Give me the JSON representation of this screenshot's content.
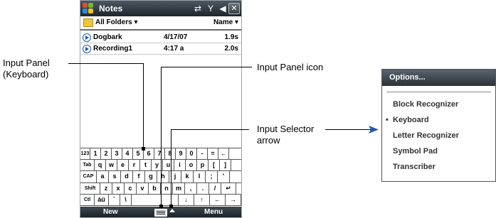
{
  "titlebar": {
    "title": "Notes",
    "close": "✕",
    "conn_glyph": "⇄",
    "signal_glyph": "Y",
    "volume_glyph": "◀"
  },
  "folderbar": {
    "folder": "All Folders ▾",
    "sort": "Name ▾"
  },
  "files": [
    {
      "name": "Dogbark",
      "date": "4/17/07",
      "size": "1.9s"
    },
    {
      "name": "Recording1",
      "date": "4:17 a",
      "size": "2.0s"
    }
  ],
  "keyboard": {
    "rows": [
      [
        "123",
        "1",
        "2",
        "3",
        "4",
        "5",
        "6",
        "7",
        "8",
        "9",
        "0",
        "-",
        "=",
        "←"
      ],
      [
        "Tab",
        "q",
        "w",
        "e",
        "r",
        "t",
        "y",
        "u",
        "i",
        "o",
        "p",
        "[",
        "]"
      ],
      [
        "CAP",
        "a",
        "s",
        "d",
        "f",
        "g",
        "h",
        "j",
        "k",
        "l",
        ";",
        "'"
      ],
      [
        "Shift",
        "z",
        "x",
        "c",
        "v",
        "b",
        "n",
        "m",
        ",",
        ".",
        "/",
        "↵"
      ],
      [
        "Ctl",
        "áü",
        "`",
        "\\",
        "",
        "↓",
        "↑",
        "←",
        "→"
      ]
    ]
  },
  "menubar": {
    "left": "New",
    "right": "Menu"
  },
  "callouts": {
    "input_panel_line1": "Input Panel",
    "input_panel_line2": "(Keyboard)",
    "input_panel_icon": "Input Panel icon",
    "input_selector_line1": "Input Selector",
    "input_selector_line2": "arrow"
  },
  "options": {
    "header": "Options...",
    "items": [
      {
        "label": "Block Recognizer",
        "selected": false
      },
      {
        "label": "Keyboard",
        "selected": true
      },
      {
        "label": "Letter Recognizer",
        "selected": false
      },
      {
        "label": "Symbol Pad",
        "selected": false
      },
      {
        "label": "Transcriber",
        "selected": false
      }
    ]
  },
  "colors": {
    "titlebar": "#2f383f",
    "accent": "#1e5aa8"
  }
}
